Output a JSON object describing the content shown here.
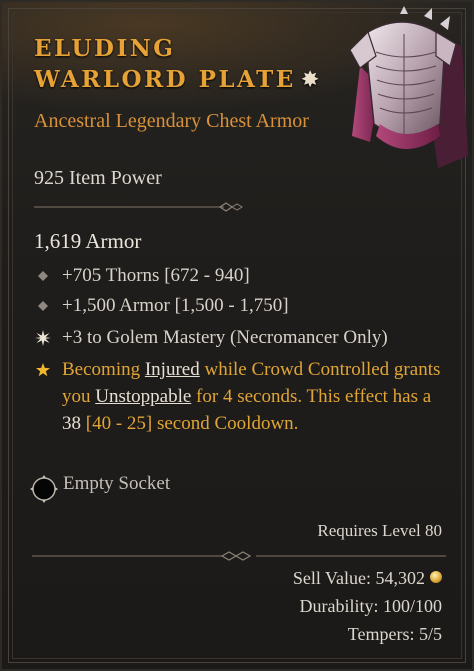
{
  "item": {
    "name": "Eluding Warlord Plate",
    "type_line": "Ancestral Legendary Chest Armor",
    "item_power": "925 Item Power",
    "base_stat": "1,619 Armor"
  },
  "affixes": [
    {
      "text": "+705 Thorns [672 - 940]",
      "icon": "diamond-bullet-icon"
    },
    {
      "text": "+1,500 Armor [1,500 - 1,750]",
      "icon": "diamond-bullet-icon"
    },
    {
      "text": "+3 to Golem Mastery (Necromancer Only)",
      "icon": "burst-bullet-icon"
    }
  ],
  "legendary_aspect": {
    "icon": "legendary-star-icon",
    "part1": "Becoming ",
    "keyword1": "Injured",
    "part2": " while Crowd Controlled grants you ",
    "keyword2": "Unstoppable",
    "part3": " for 4 seconds. This effect has a ",
    "value": "38",
    "part4": " [40 - 25] second Cooldown."
  },
  "socket": {
    "label": "Empty Socket",
    "icon": "socket-icon"
  },
  "requirements": {
    "level": "Requires Level 80"
  },
  "footer": {
    "sell_value": "Sell Value: 54,302",
    "durability": "Durability: 100/100",
    "tempers": "Tempers: 5/5"
  },
  "colors": {
    "title": "#e6a235",
    "legendary_text": "#e0a535",
    "base_text": "#d8d3ca",
    "background": "#211f1c"
  }
}
